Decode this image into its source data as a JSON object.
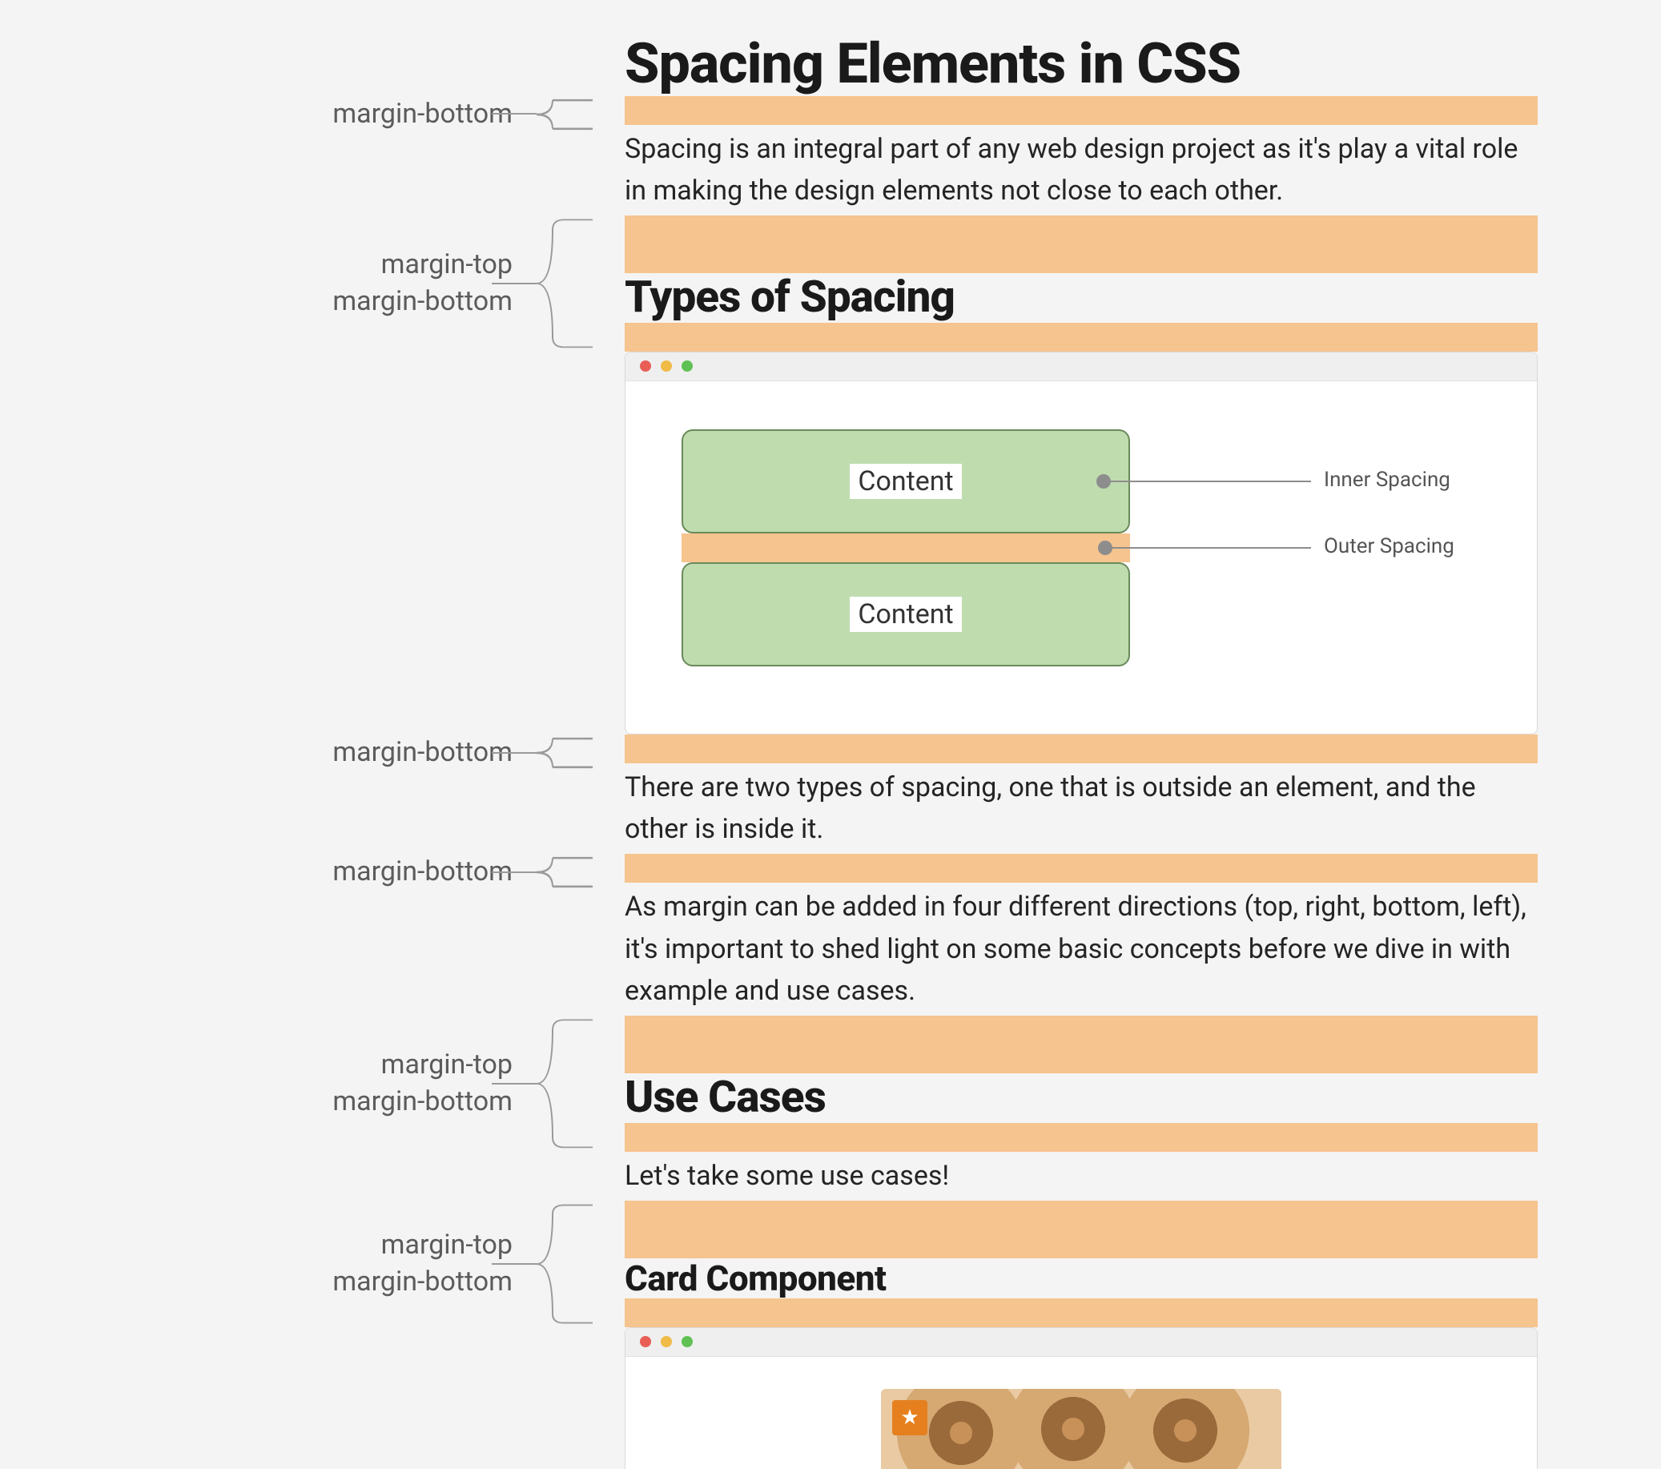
{
  "annotations": {
    "a1": "margin-bottom",
    "a2_line1": "margin-top",
    "a2_line2": "margin-bottom",
    "a3": "margin-bottom",
    "a4": "margin-bottom",
    "a5_line1": "margin-top",
    "a5_line2": "margin-bottom",
    "a6_line1": "margin-top",
    "a6_line2": "margin-bottom"
  },
  "article": {
    "title": "Spacing Elements in CSS",
    "intro": "Spacing is an integral part of any web design project as it's play a vital role in making the design elements not close to each other.",
    "h2_types": "Types of Spacing",
    "p_types": "There are two types of spacing, one that is outside an element, and the other is inside it.",
    "p_margin": "As margin can be added in four different directions (top, right, bottom, left), it's important to shed light on some basic concepts before we dive in with example and use cases.",
    "h2_usecases": "Use Cases",
    "p_usecases": "Let's take some use cases!",
    "h3_card": "Card Component"
  },
  "diagram": {
    "box_label_1": "Content",
    "box_label_2": "Content",
    "inner_label": "Inner Spacing",
    "outer_label": "Outer Spacing"
  },
  "icons": {
    "star": "★"
  }
}
